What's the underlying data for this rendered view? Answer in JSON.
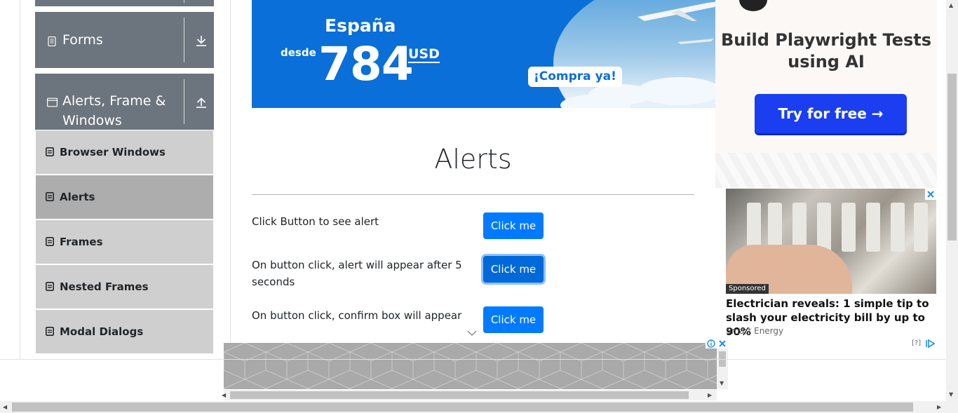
{
  "sidebar": {
    "groups": [
      {
        "label": "Forms",
        "icon": "document-icon",
        "arrow": "download-arrow-icon"
      },
      {
        "label": "Alerts, Frame &\nWindows",
        "icon": "window-icon",
        "arrow": "upload-arrow-icon"
      }
    ],
    "items": [
      {
        "label": "Browser Windows",
        "active": false
      },
      {
        "label": "Alerts",
        "active": true
      },
      {
        "label": "Frames",
        "active": false
      },
      {
        "label": "Nested Frames",
        "active": false
      },
      {
        "label": "Modal Dialogs",
        "active": false
      }
    ]
  },
  "banner_ad": {
    "destination": "España",
    "desde": "desde",
    "price": "784",
    "currency": "USD",
    "cta": "¡Compra ya!"
  },
  "main": {
    "title": "Alerts",
    "rows": [
      {
        "text": "Click Button to see alert",
        "button": "Click me"
      },
      {
        "text": "On button click, alert will appear after 5 seconds",
        "button": "Click me"
      },
      {
        "text": "On button click, confirm box will appear",
        "button": "Click me"
      }
    ]
  },
  "right_ad": {
    "headline": "Build Playwright Tests using AI",
    "cta": "Try for free →",
    "sponsored": "Sponsored",
    "article_title": "Electrician reveals: 1 simple tip to slash your electricity bill by up to 90%",
    "source": "Smart Energy",
    "question": "[?]"
  },
  "colors": {
    "sidebar_header": "#6c757d",
    "menu_item": "#cfcfcf",
    "menu_item_active": "#adadad",
    "primary_button": "#007bff",
    "banner_blue": "#0a6fd8",
    "cta_blue": "#1a3ef0"
  }
}
